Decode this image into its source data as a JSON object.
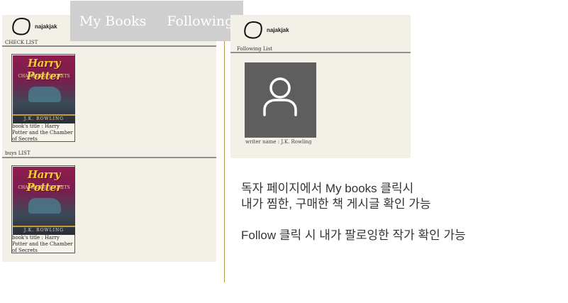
{
  "app": {
    "username": "najakjak"
  },
  "tabs": {
    "my_books": "My Books",
    "following": "Following"
  },
  "my_books_panel": {
    "check_list_label": "CHECK LIST",
    "buys_list_label": "buys LIST",
    "check_list": [
      {
        "cover_title": "Harry Potter",
        "cover_subtitle": "CHAMBER of SECRETS",
        "cover_author": "J.K. ROWLING",
        "caption": "book's title : Harry Potter and the Chamber of Secrets"
      }
    ],
    "buys_list": [
      {
        "cover_title": "Harry Potter",
        "cover_subtitle": "CHAMBER of SECRETS",
        "cover_author": "J.K. ROWLING",
        "caption": "book's title : Harry Potter and the Chamber of Secrets"
      }
    ]
  },
  "following_panel": {
    "following_list_label": "Following List",
    "writers": [
      {
        "caption": "writer name : J.K. Rowling",
        "icon": "user-icon"
      }
    ]
  },
  "notes": {
    "line1": "독자 페이지에서  My books 클릭시",
    "line2": "내가 찜한, 구매한 책 게시글 확인 가능",
    "line3": "Follow 클릭 시 내가 팔로잉한 작가 확인 가능"
  },
  "colors": {
    "panel_bg": "#f3f0e7",
    "tab_bg": "#cfcfcf",
    "divider": "#b89b4a",
    "writer_card": "#5e5e5e"
  }
}
